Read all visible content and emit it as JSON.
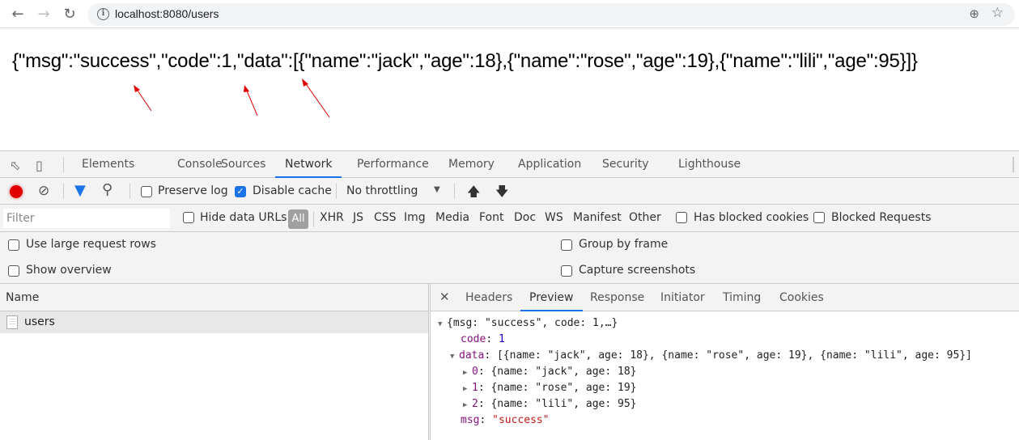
{
  "browser": {
    "back_icon": "arrow-left-icon",
    "forward_icon": "arrow-right-icon",
    "reload_icon": "reload-icon",
    "url": "localhost:8080/users"
  },
  "page": {
    "raw_json": "{\"msg\":\"success\",\"code\":1,\"data\":[{\"name\":\"jack\",\"age\":18},{\"name\":\"rose\",\"age\":19},{\"name\":\"lili\",\"age\":95}]}",
    "annotation_color": "#e00000"
  },
  "devtools": {
    "tabs": [
      {
        "label": "Elements"
      },
      {
        "label": "Console"
      },
      {
        "label": "Sources"
      },
      {
        "label": "Network",
        "active": true
      },
      {
        "label": "Performance"
      },
      {
        "label": "Memory"
      },
      {
        "label": "Application"
      },
      {
        "label": "Security"
      },
      {
        "label": "Lighthouse"
      }
    ],
    "toolbar": {
      "preserve_log": "Preserve log",
      "disable_cache": "Disable cache",
      "throttling": "No throttling"
    },
    "filter": {
      "placeholder": "Filter",
      "hide_data_urls": "Hide data URLs",
      "types": [
        "All",
        "XHR",
        "JS",
        "CSS",
        "Img",
        "Media",
        "Font",
        "Doc",
        "WS",
        "Manifest",
        "Other"
      ],
      "has_blocked_cookies": "Has blocked cookies",
      "blocked_requests": "Blocked Requests"
    },
    "settings": {
      "use_large_rows": "Use large request rows",
      "show_overview": "Show overview",
      "group_by_frame": "Group by frame",
      "capture_screenshots": "Capture screenshots"
    },
    "requests": {
      "header": "Name",
      "rows": [
        {
          "name": "users"
        }
      ]
    },
    "detail_tabs": [
      {
        "label": "Headers"
      },
      {
        "label": "Preview",
        "active": true
      },
      {
        "label": "Response"
      },
      {
        "label": "Initiator"
      },
      {
        "label": "Timing"
      },
      {
        "label": "Cookies"
      }
    ],
    "preview": {
      "root_summary": "{msg: \"success\", code: 1,…}",
      "code_key": "code",
      "code_value": "1",
      "data_key": "data",
      "data_summary": "[{name: \"jack\", age: 18}, {name: \"rose\", age: 19}, {name: \"lili\", age: 95}]",
      "items": [
        {
          "index": "0",
          "summary": "{name: \"jack\", age: 18}"
        },
        {
          "index": "1",
          "summary": "{name: \"rose\", age: 19}"
        },
        {
          "index": "2",
          "summary": "{name: \"lili\", age: 95}"
        }
      ],
      "msg_key": "msg",
      "msg_value": "\"success\""
    }
  }
}
